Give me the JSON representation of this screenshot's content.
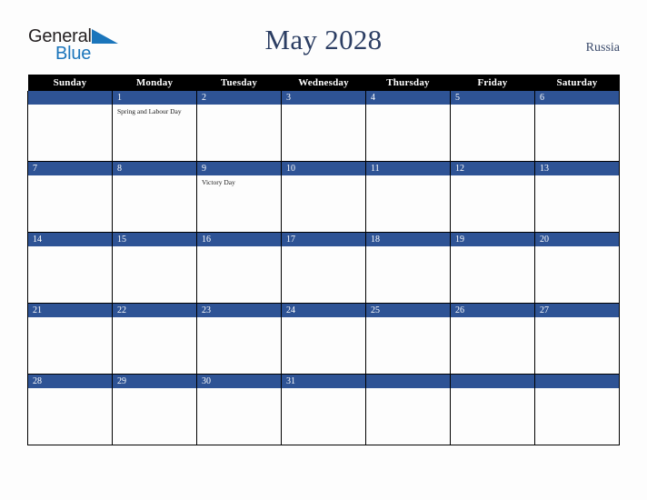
{
  "brand": {
    "name_top": "General",
    "name_bottom": "Blue",
    "triangle_icon": "triangle-icon",
    "color_top": "#231f20",
    "color_bottom": "#1b75bb"
  },
  "header": {
    "title": "May 2028",
    "country": "Russia",
    "title_color": "#2c3e63"
  },
  "calendar": {
    "month": "May",
    "year": "2028",
    "accent_color": "#2e5395",
    "header_bg": "#000000",
    "weekday_headers": [
      "Sunday",
      "Monday",
      "Tuesday",
      "Wednesday",
      "Thursday",
      "Friday",
      "Saturday"
    ],
    "weeks": [
      [
        {
          "day": "",
          "events": []
        },
        {
          "day": "1",
          "events": [
            "Spring and Labour Day"
          ]
        },
        {
          "day": "2",
          "events": []
        },
        {
          "day": "3",
          "events": []
        },
        {
          "day": "4",
          "events": []
        },
        {
          "day": "5",
          "events": []
        },
        {
          "day": "6",
          "events": []
        }
      ],
      [
        {
          "day": "7",
          "events": []
        },
        {
          "day": "8",
          "events": []
        },
        {
          "day": "9",
          "events": [
            "Victory Day"
          ]
        },
        {
          "day": "10",
          "events": []
        },
        {
          "day": "11",
          "events": []
        },
        {
          "day": "12",
          "events": []
        },
        {
          "day": "13",
          "events": []
        }
      ],
      [
        {
          "day": "14",
          "events": []
        },
        {
          "day": "15",
          "events": []
        },
        {
          "day": "16",
          "events": []
        },
        {
          "day": "17",
          "events": []
        },
        {
          "day": "18",
          "events": []
        },
        {
          "day": "19",
          "events": []
        },
        {
          "day": "20",
          "events": []
        }
      ],
      [
        {
          "day": "21",
          "events": []
        },
        {
          "day": "22",
          "events": []
        },
        {
          "day": "23",
          "events": []
        },
        {
          "day": "24",
          "events": []
        },
        {
          "day": "25",
          "events": []
        },
        {
          "day": "26",
          "events": []
        },
        {
          "day": "27",
          "events": []
        }
      ],
      [
        {
          "day": "28",
          "events": []
        },
        {
          "day": "29",
          "events": []
        },
        {
          "day": "30",
          "events": []
        },
        {
          "day": "31",
          "events": []
        },
        {
          "day": "",
          "events": []
        },
        {
          "day": "",
          "events": []
        },
        {
          "day": "",
          "events": []
        }
      ]
    ]
  }
}
